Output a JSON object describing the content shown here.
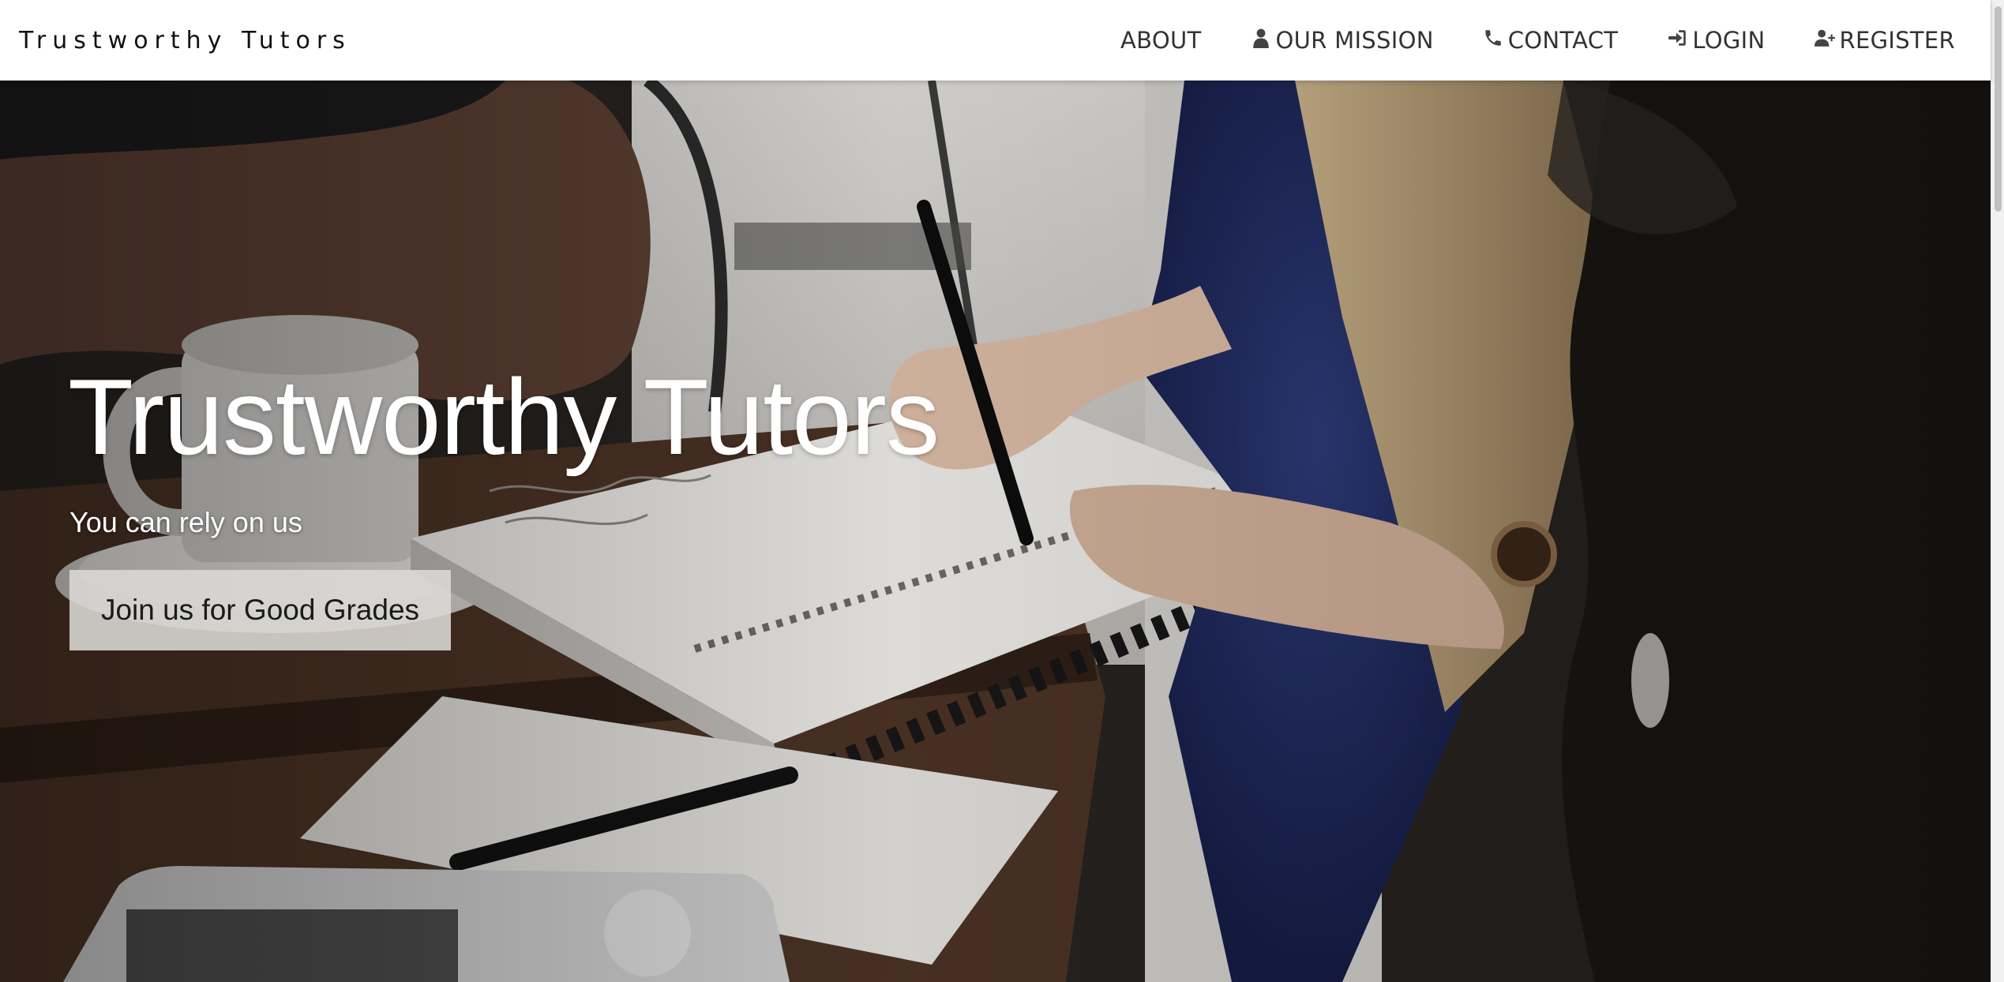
{
  "navbar": {
    "brand": "Trustworthy Tutors",
    "links": [
      {
        "label": "ABOUT",
        "icon": ""
      },
      {
        "label": "OUR MISSION",
        "icon": "user-icon"
      },
      {
        "label": "CONTACT",
        "icon": "phone-icon"
      },
      {
        "label": "LOGIN",
        "icon": "sign-in-icon"
      },
      {
        "label": "REGISTER",
        "icon": "user-plus-icon"
      }
    ]
  },
  "hero": {
    "title": "Trustworthy Tutors",
    "subtitle": "You can rely on us",
    "button_label": "Join us for Good Grades",
    "background": "photo of students studying at a table with notebooks, pens, coffee cup and laptop"
  },
  "colors": {
    "navbar_bg": "#ffffff",
    "nav_text": "#333333",
    "hero_text": "#ffffff",
    "button_bg": "#dcd9d6"
  }
}
